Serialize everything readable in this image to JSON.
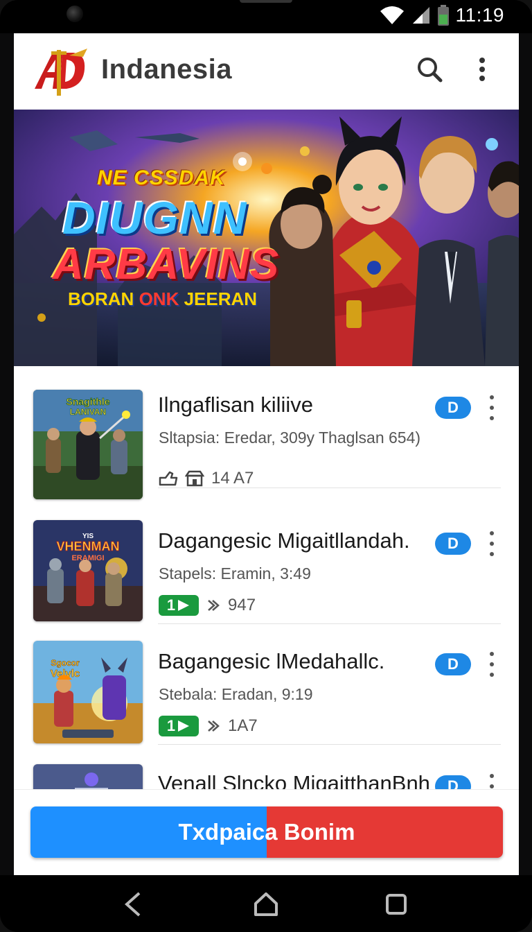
{
  "status_bar": {
    "time": "11:19"
  },
  "app_bar": {
    "title": "Indanesia",
    "icons": [
      "app-logo",
      "search-icon",
      "more-vert-icon"
    ]
  },
  "banner": {
    "line1": "NE CSSDAK",
    "line2": "DIUGNN",
    "line3": "ARBAVINS",
    "line4a": "BORAN",
    "line4b": "ONK",
    "line4c": "JEERAN"
  },
  "games": [
    {
      "title": "Ilngaflisan kiliive",
      "subtitle": "Sltapsia: Eredar, 309y Thaglsan 654)",
      "meta": "14 A7",
      "badge": "D",
      "icons": [
        "controller-icon",
        "store-icon"
      ]
    },
    {
      "title": "Dagangesic Migaitllandah.",
      "subtitle": "Stapels: Eramin, 3:49",
      "meta": "947",
      "badge": "D",
      "play_label": "1",
      "icons": [
        "play-badge-icon",
        "speed-icon"
      ]
    },
    {
      "title": "Bagangesic lMedahallc.",
      "subtitle": "Stebala: Eradan, 9:19",
      "meta": "1A7",
      "badge": "D",
      "play_label": "1",
      "icons": [
        "play-badge-icon",
        "speed-icon"
      ]
    },
    {
      "title": "Venall Slncko MigaitthanBnh",
      "badge": "D"
    }
  ],
  "cta": {
    "label": "Txdpaica Bonim"
  },
  "nav": {
    "icons": [
      "back-icon",
      "home-icon",
      "recents-icon"
    ]
  },
  "colors": {
    "accent_blue": "#1e88e5",
    "cta_blue": "#1e90ff",
    "cta_red": "#e53935",
    "green": "#1a9a3e"
  }
}
